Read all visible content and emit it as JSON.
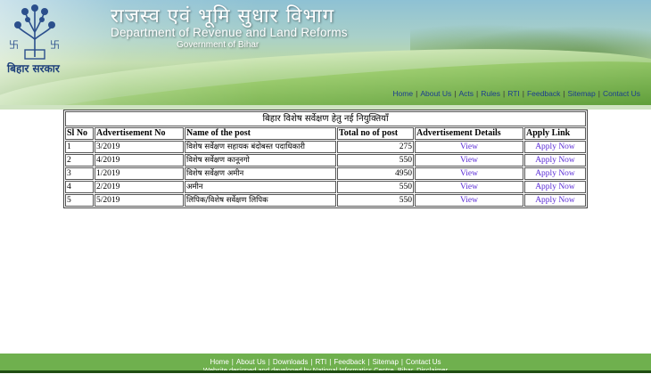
{
  "header": {
    "title_hindi": "राजस्व एवं भूमि सुधार विभाग",
    "title_english": "Department of Revenue and Land Reforms",
    "government": "Government of Bihar",
    "state_name": "बिहार सरकार",
    "nav": [
      "Home",
      "About Us",
      "Acts",
      "Rules",
      "RTI",
      "Feedback",
      "Sitemap",
      "Contact Us"
    ]
  },
  "table": {
    "caption": "बिहार विशेष सर्वेक्षण हेतु नई नियुक्तियाँ",
    "headers": [
      "Sl No",
      "Advertisement No",
      "Name of the post",
      "Total no of post",
      "Advertisement Details",
      "Apply Link"
    ],
    "rows": [
      {
        "sl": "1",
        "adv": "3/2019",
        "post": "विशेष सर्वेक्षण सहायक बंदोबस्त पदाधिकारी",
        "total": "275",
        "details": "View",
        "apply": "Apply Now"
      },
      {
        "sl": "2",
        "adv": "4/2019",
        "post": "विशेष सर्वेक्षण कानूनगो",
        "total": "550",
        "details": "View",
        "apply": "Apply Now"
      },
      {
        "sl": "3",
        "adv": "1/2019",
        "post": "विशेष सर्वेक्षण अमीन",
        "total": "4950",
        "details": "View",
        "apply": "Apply Now"
      },
      {
        "sl": "4",
        "adv": "2/2019",
        "post": "अमीन",
        "total": "550",
        "details": "View",
        "apply": "Apply Now"
      },
      {
        "sl": "5",
        "adv": "5/2019",
        "post": "लिपिक/विशेष सर्वेक्षण लिपिक",
        "total": "550",
        "details": "View",
        "apply": "Apply Now"
      }
    ]
  },
  "footer": {
    "nav": [
      "Home",
      "About Us",
      "Downloads",
      "RTI",
      "Feedback",
      "Sitemap",
      "Contact Us"
    ],
    "credit": "Website designed and developed by National Informatics Centre, Bihar. Disclaimer"
  },
  "colors": {
    "footer_bg": "#6fb04e",
    "link": "#5a2bd6",
    "nav_link": "#1a3d8f"
  }
}
